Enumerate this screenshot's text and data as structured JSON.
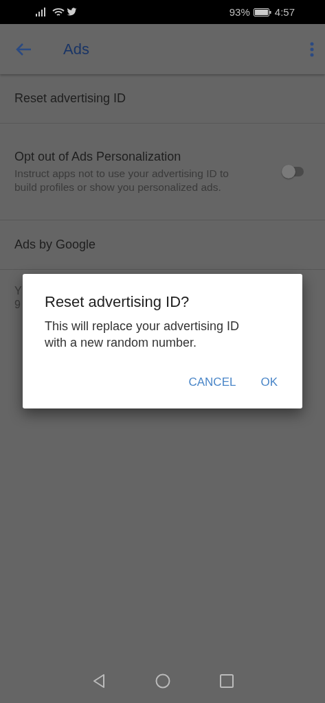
{
  "status_bar": {
    "battery": "93%",
    "time": "4:57"
  },
  "app_bar": {
    "title": "Ads"
  },
  "settings": [
    {
      "kind": "link",
      "title": "Reset advertising ID"
    },
    {
      "kind": "toggle",
      "title": "Opt out of Ads Personalization",
      "summary": "Instruct apps not to use your advertising ID to build profiles or show you personalized ads.",
      "on": false
    },
    {
      "kind": "link",
      "title": "Ads by Google"
    }
  ],
  "footer_lines": [
    "Y",
    "9"
  ],
  "dialog": {
    "title": "Reset advertising ID?",
    "message": "This will replace your advertising ID with a new random number.",
    "buttons": [
      "CANCEL",
      "OK"
    ]
  }
}
